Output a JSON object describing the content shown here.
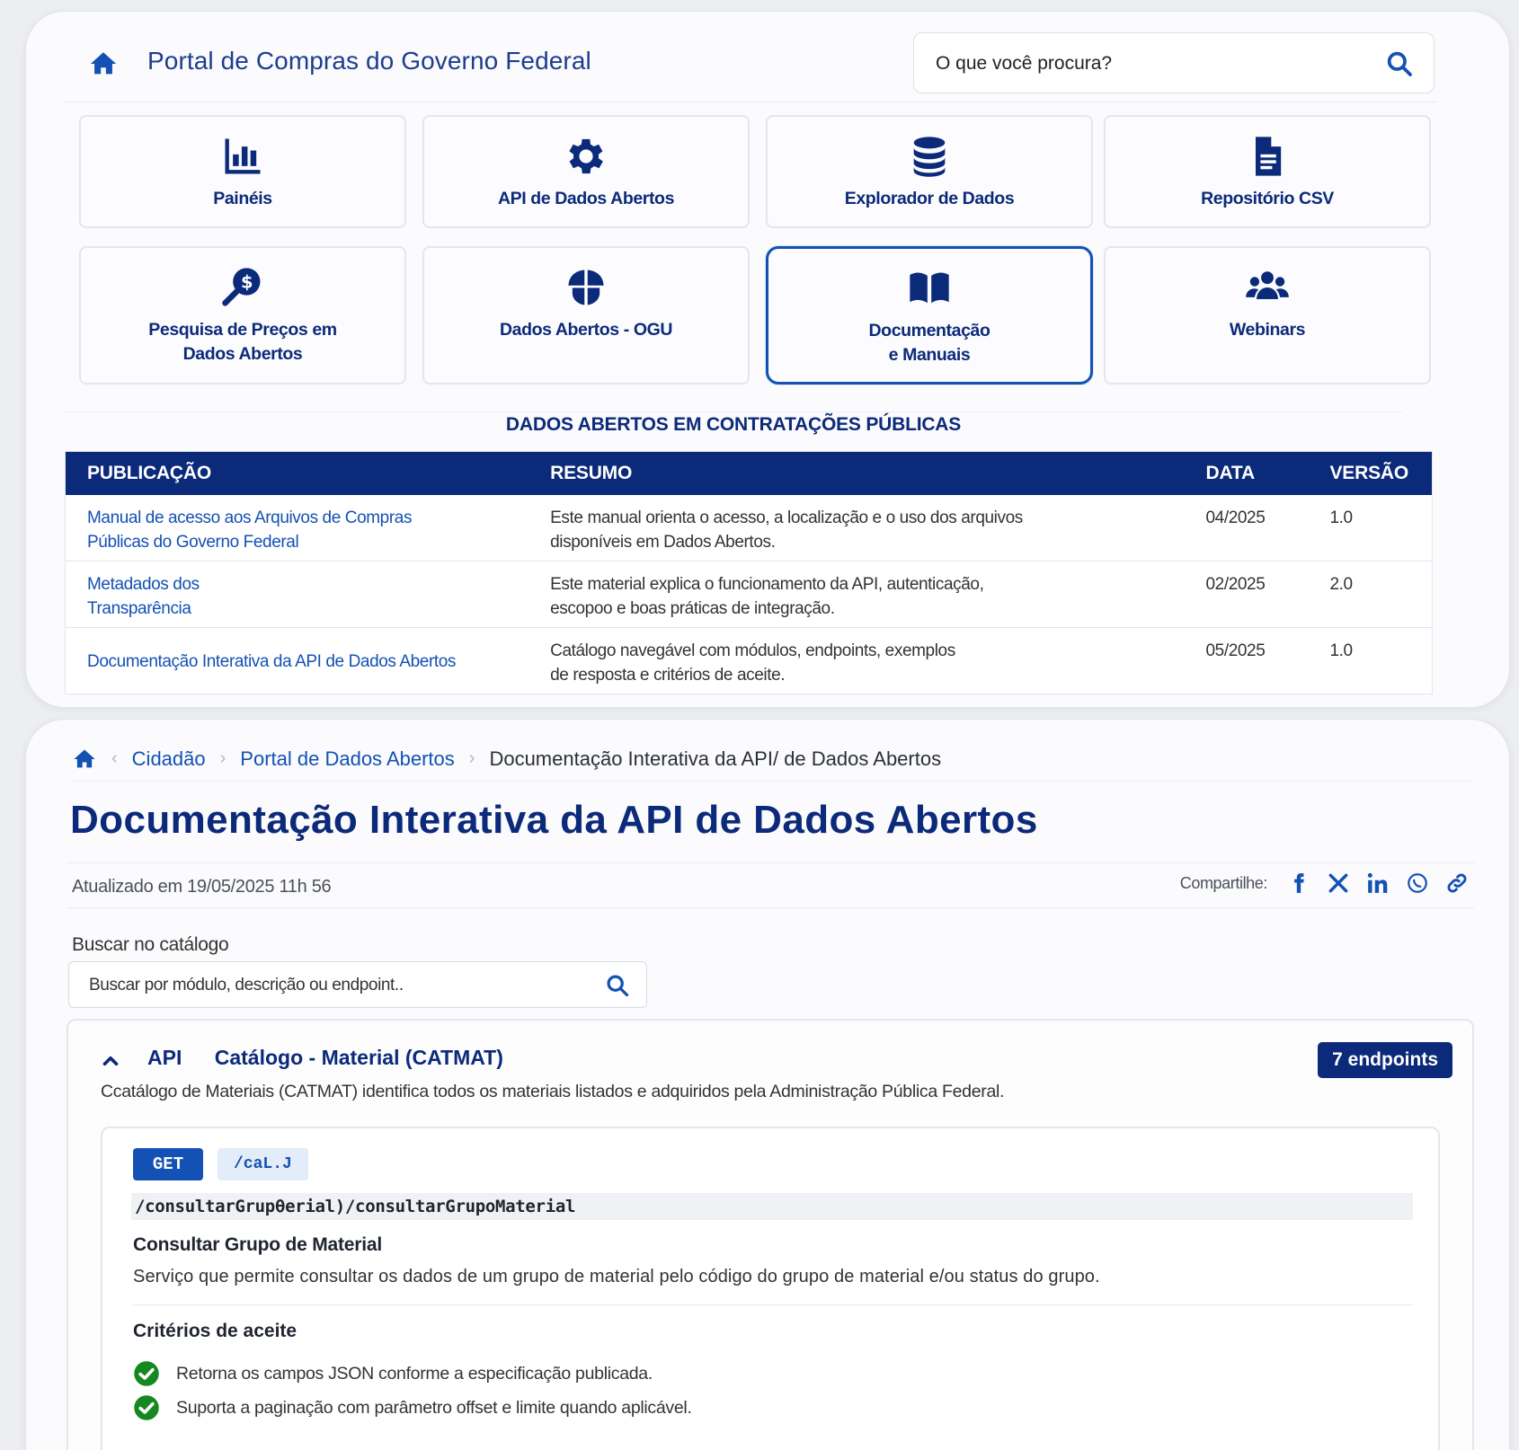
{
  "header": {
    "title": "Portal de Compras do Governo Federal",
    "search_placeholder": "O que você procura?"
  },
  "tiles": [
    {
      "label": "Painéis",
      "icon": "chart-bars-icon"
    },
    {
      "label": "API de Dados Abertos",
      "icon": "gear-icon"
    },
    {
      "label": "Explorador de Dados",
      "icon": "database-icon"
    },
    {
      "label": "Repositório CSV",
      "icon": "file-icon"
    },
    {
      "label_line1": "Pesquisa de Preços em",
      "label_line2": "Dados Abertos",
      "icon": "price-search-icon"
    },
    {
      "label": "Dados Abertos - OGU",
      "icon": "umbrella-icon"
    },
    {
      "label_line1": "Documentação",
      "label_line2": "e Manuais",
      "icon": "book-icon",
      "active": true
    },
    {
      "label": "Webinars",
      "icon": "users-icon"
    }
  ],
  "publications": {
    "heading": "DADOS ABERTOS EM CONTRATAÇÕES PÚBLICAS",
    "columns": [
      "PUBLICAÇÃO",
      "RESUMO",
      "DATA",
      "VERSÃO"
    ],
    "rows": [
      {
        "title_line1": "Manual de acesso aos Arquivos de Compras",
        "title_line2": "Públicas do Governo Federal",
        "summary_line1": "Este manual orienta o acesso, a localização e o uso dos arquivos",
        "summary_line2": "disponíveis em Dados Abertos.",
        "date": "04/2025",
        "version": "1.0"
      },
      {
        "title_line1": "Metadados dos",
        "title_line2": "Transparência",
        "summary_line1": "Este material explica o funcionamento da API, autenticação,",
        "summary_line2": "escopoo e boas práticas de integração.",
        "date": "02/2025",
        "version": "2.0"
      },
      {
        "title_line1": "Documentação Interativa da API de Dados Abertos",
        "title_line2": "",
        "summary_line1": "Catálogo navegável com módulos, endpoints, exemplos",
        "summary_line2": "de resposta e critérios de aceite.",
        "date": "05/2025",
        "version": "1.0"
      }
    ]
  },
  "breadcrumb": {
    "items": [
      "Cidadão",
      "Portal de Dados Abertos"
    ],
    "current": "Documentação Interativa da API/ de Dados Abertos"
  },
  "page": {
    "title": "Documentação Interativa da API de Dados Abertos",
    "updated": "Atualizado em 19/05/2025 11h 56",
    "share_label": "Compartilhe:"
  },
  "share_icons": [
    "facebook-icon",
    "x-icon",
    "linkedin-icon",
    "whatsapp-icon",
    "link-icon"
  ],
  "catalog": {
    "label": "Buscar no catálogo",
    "placeholder": "Buscar por módulo, descrição ou endpoint.."
  },
  "module": {
    "api_tag": "API",
    "name": "Catálogo - Material (CATMAT)",
    "badge": "7 endpoints",
    "description": "Ccatálogo de Materiais (CATMAT) identifica todos os materiais listados e adquiridos pela Administração Pública Federal.",
    "endpoint": {
      "method": "GET",
      "path_short": "/caL.J",
      "path_full": "/consultarGrupθerial)/consultarGrupoMaterial",
      "title": "Consultar Grupo de Material",
      "description": "Serviço que permite consultar os dados de um grupo de material pelo código do grupo de material e/ou status do grupo.",
      "criteria_title": "Critérios de aceite",
      "criteria": [
        "Retorna os campos JSON conforme a especificação publicada.",
        "Suporta a paginação com parâmetro offset e limite quando aplicável."
      ]
    }
  },
  "colors": {
    "primary": "#0c2a7a",
    "link": "#1351b4",
    "success": "#168821"
  }
}
